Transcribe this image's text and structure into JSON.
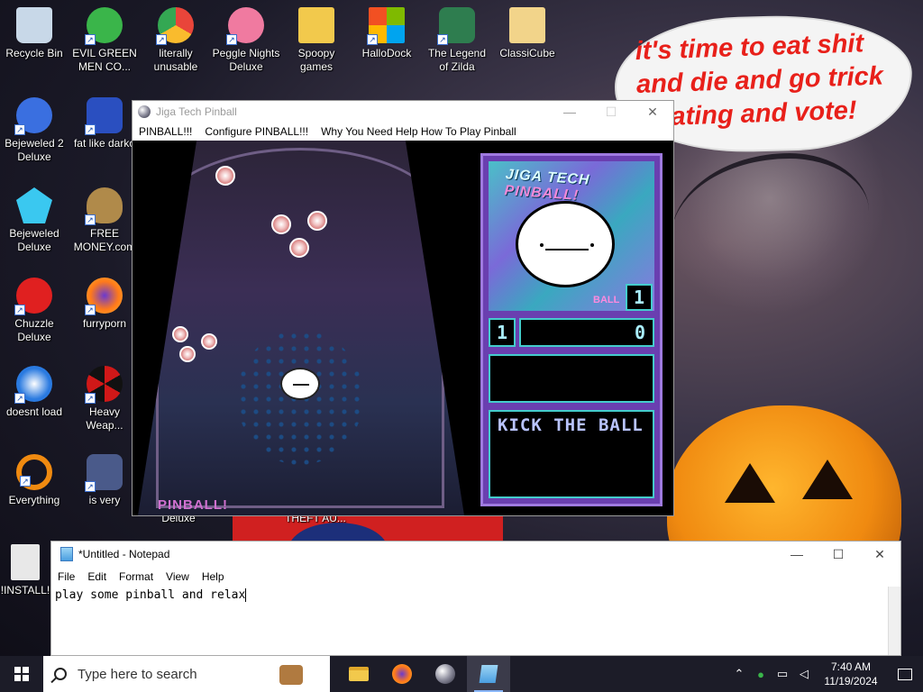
{
  "desktop": {
    "icons": [
      {
        "label": "Recycle Bin",
        "color": "#c8d8e8"
      },
      {
        "label": "EVIL GREEN MEN CO...",
        "color": "#3ab54a"
      },
      {
        "label": "literally unusable",
        "color": "#e9453a"
      },
      {
        "label": "Peggle Nights Deluxe",
        "color": "#f07aa0"
      },
      {
        "label": "Spoopy games",
        "color": "#f2c94c"
      },
      {
        "label": "HalloDock",
        "color": "#f25022"
      },
      {
        "label": "The Legend of Zilda",
        "color": "#2e7d4f"
      },
      {
        "label": "ClassiCube",
        "color": "#f2d48a"
      },
      {
        "label": "Bejeweled 2 Deluxe",
        "color": "#3a6fe0"
      },
      {
        "label": "fat like darko",
        "color": "#2a4fc0"
      },
      {
        "label": "Bejeweled Deluxe",
        "color": "#3ac8f0"
      },
      {
        "label": "FREE MONEY.com",
        "color": "#b08a4a"
      },
      {
        "label": "Chuzzle Deluxe",
        "color": "#e02020"
      },
      {
        "label": "furryporn",
        "color": "#ff7a1a"
      },
      {
        "label": "doesnt load",
        "color": "#2a7ae0"
      },
      {
        "label": "Heavy Weap...",
        "color": "#d01818"
      },
      {
        "label": "Everything",
        "color": "#f08a10"
      },
      {
        "label": "is very",
        "color": "#4a5a8a"
      },
      {
        "label": "!INSTALL!",
        "color": "#e8e8e8"
      },
      {
        "label": "Deluxe",
        "color": "#000000"
      },
      {
        "label": "THEFT AU...",
        "color": "#000000"
      }
    ],
    "bubble_lines": [
      "it's time to eat shit",
      "and die and go trick",
      "treating and vote!"
    ]
  },
  "pinball": {
    "title": "Jiga Tech Pinball",
    "menu": [
      "PINBALL!!!",
      "Configure PINBALL!!!",
      "Why You Need Help How To Play Pinball"
    ],
    "logo_text": "PINBALL!",
    "panel_title_a": "JIGA TECH ",
    "panel_title_b": "PINBALL!",
    "ball_label": "BALL",
    "ball_number": "1",
    "player_number": "1",
    "score": "0",
    "message": "KICK THE BALL"
  },
  "notepad": {
    "title": "*Untitled - Notepad",
    "menu": [
      "File",
      "Edit",
      "Format",
      "View",
      "Help"
    ],
    "text": "play some pinball and relax"
  },
  "taskbar": {
    "search_placeholder": "Type here to search",
    "time": "7:40 AM",
    "date": "11/19/2024",
    "apps": [
      "file-explorer-icon",
      "firefox-icon",
      "pinball-icon",
      "notepad-icon"
    ]
  },
  "window_controls": {
    "minimize": "—",
    "maximize": "☐",
    "close": "✕"
  }
}
